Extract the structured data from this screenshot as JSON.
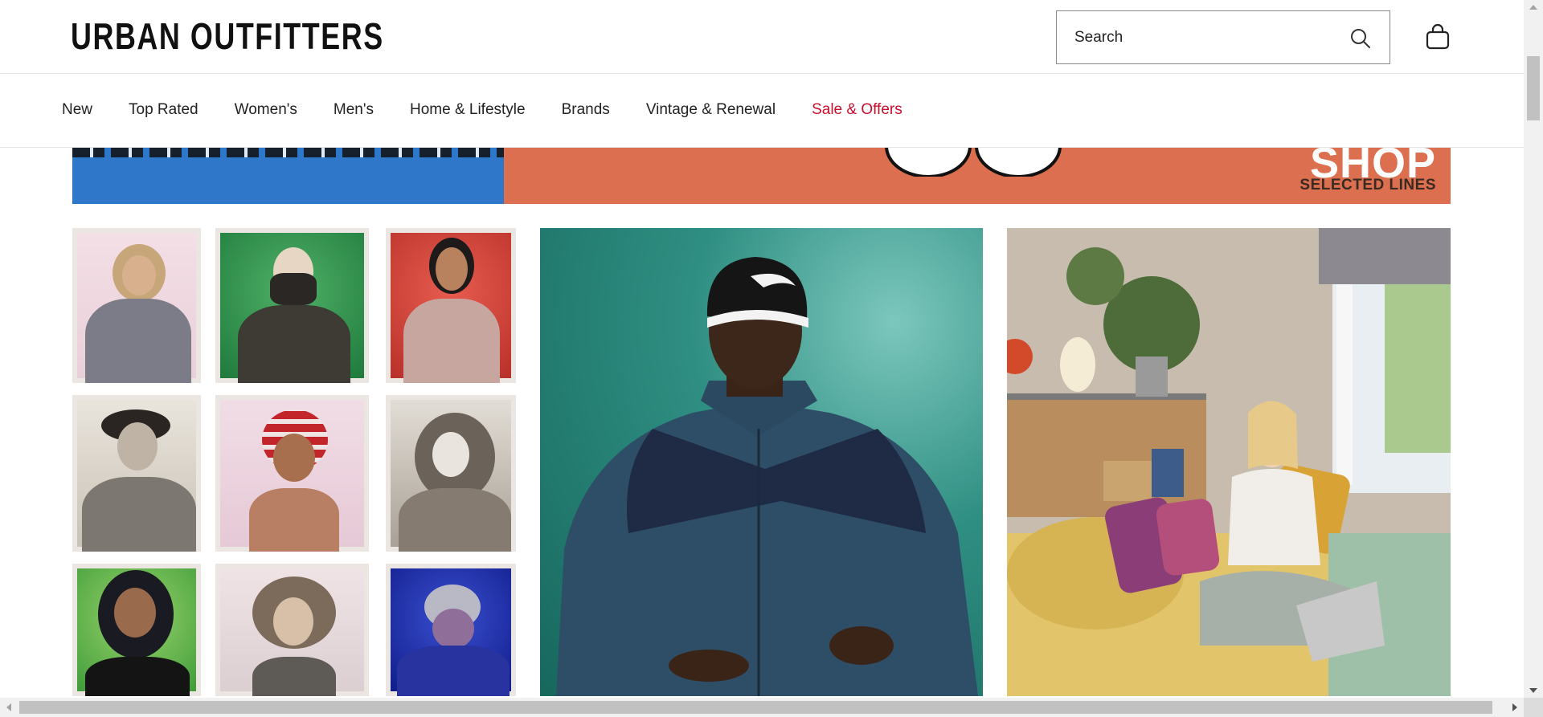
{
  "brand": {
    "logo_text": "URBAN OUTFITTERS"
  },
  "search": {
    "placeholder": "Search",
    "value": ""
  },
  "icons": {
    "search": "search-icon",
    "bag": "shopping-bag-icon"
  },
  "nav": {
    "items": [
      {
        "label": "New"
      },
      {
        "label": "Top Rated"
      },
      {
        "label": "Women's"
      },
      {
        "label": "Men's"
      },
      {
        "label": "Home & Lifestyle"
      },
      {
        "label": "Brands"
      },
      {
        "label": "Vintage & Renewal"
      },
      {
        "label": "Sale & Offers"
      }
    ],
    "sale_color": "#c8102e"
  },
  "banner": {
    "headline": "SHOP",
    "subline": "SELECTED LINES",
    "left_color": "#2f78c9",
    "right_color": "#dc6f50"
  },
  "tiles": {
    "polaroids": [
      {
        "subject": "model in fur-trimmed hood and cap"
      },
      {
        "subject": "model in balaclava on green backdrop"
      },
      {
        "subject": "model in corset top on red backdrop"
      },
      {
        "subject": "model in black beret"
      },
      {
        "subject": "model in red striped knit hat"
      },
      {
        "subject": "model in furry hooded coat"
      },
      {
        "subject": "model in black hood on green backdrop"
      },
      {
        "subject": "model in fur trapper hat"
      },
      {
        "subject": "model in grey knit hat on blue backdrop"
      }
    ],
    "hero": {
      "subject": "man in beanie and fleece jacket"
    },
    "room": {
      "subject": "girl on bed with laptop in decorated bedroom"
    }
  }
}
